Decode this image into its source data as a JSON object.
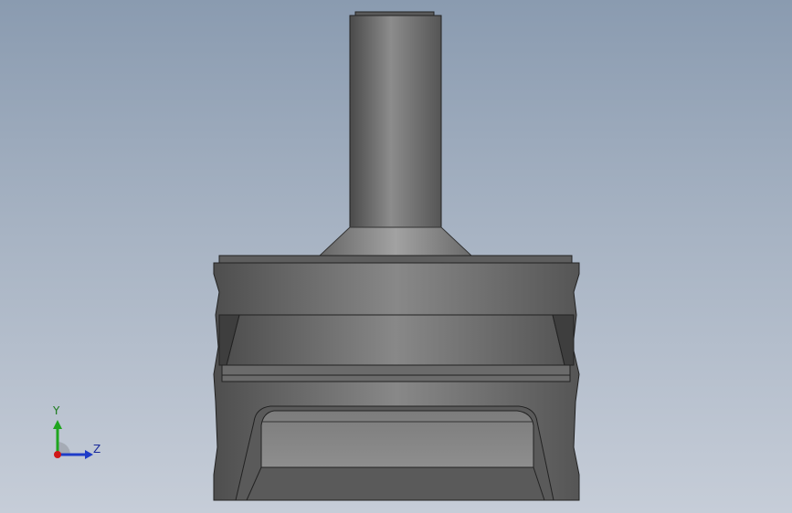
{
  "viewport": {
    "background_top": "#8a9bb0",
    "background_bottom": "#c6cdd8"
  },
  "triad": {
    "y_label": "Y",
    "z_label": "Z",
    "y_color": "#1fa51f",
    "z_color": "#1e3cc8",
    "x_color": "#d01818"
  }
}
